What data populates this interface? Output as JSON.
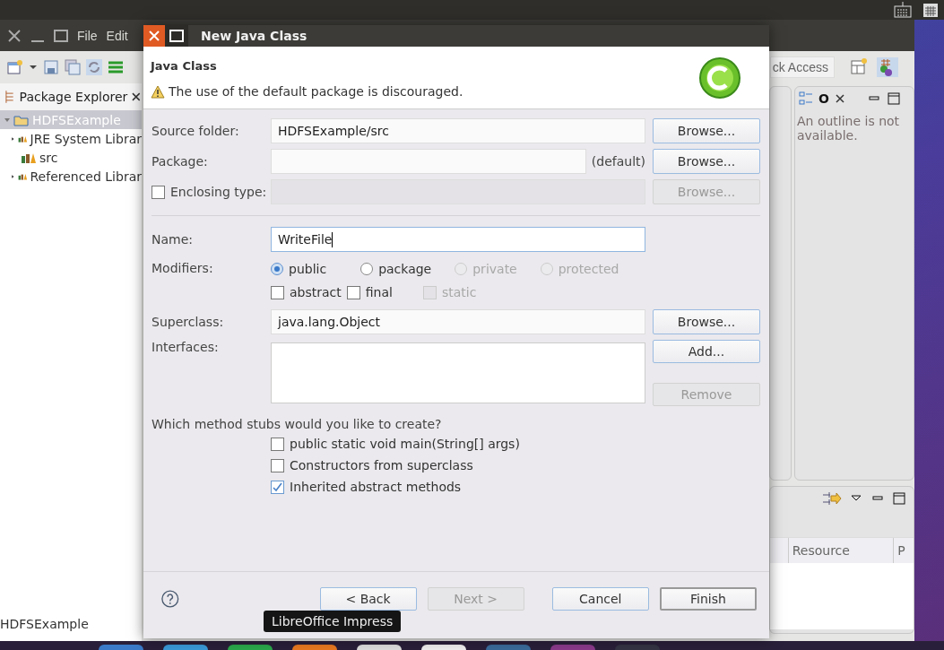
{
  "ide": {
    "menu": [
      "File",
      "Edit"
    ],
    "quick_access": "ck Access",
    "package_explorer": {
      "title": "Package Explorer",
      "tree": [
        {
          "label": "HDFSExample",
          "selected": true,
          "expanded": true,
          "children": [
            {
              "label": "JRE System Librar",
              "expanded": false
            },
            {
              "label": "src"
            },
            {
              "label": "Referenced Librar",
              "expanded": false
            }
          ]
        }
      ]
    },
    "outline": {
      "tab": "O",
      "message": "An outline is not available."
    },
    "problems": {
      "columns": [
        "Resource",
        "P"
      ]
    },
    "status_bar": "HDFSExample"
  },
  "dialog": {
    "title": "New Java Class",
    "header": {
      "title": "Java Class",
      "message": "The use of the default package is discouraged."
    },
    "source_folder": {
      "label": "Source folder:",
      "value": "HDFSExample/src",
      "button": "Browse..."
    },
    "package": {
      "label": "Package:",
      "suffix": "(default)",
      "button": "Browse..."
    },
    "enclosing_type": {
      "label": "Enclosing type:",
      "checked": false,
      "button": "Browse...",
      "disabled": true
    },
    "name": {
      "label": "Name:",
      "value": "WriteFile"
    },
    "modifiers": {
      "label": "Modifiers:",
      "options": [
        {
          "label": "public",
          "selected": true,
          "disabled": false
        },
        {
          "label": "package",
          "selected": false,
          "disabled": false
        },
        {
          "label": "private",
          "selected": false,
          "disabled": true
        },
        {
          "label": "protected",
          "selected": false,
          "disabled": true
        }
      ],
      "flags": [
        {
          "label": "abstract",
          "checked": false,
          "disabled": false
        },
        {
          "label": "final",
          "checked": false,
          "disabled": false
        },
        {
          "label": "static",
          "checked": false,
          "disabled": true
        }
      ]
    },
    "superclass": {
      "label": "Superclass:",
      "value": "java.lang.Object",
      "button": "Browse..."
    },
    "interfaces": {
      "label": "Interfaces:",
      "buttons": [
        {
          "label": "Add...",
          "disabled": false
        },
        {
          "label": "Remove",
          "disabled": true
        }
      ]
    },
    "stubs": {
      "question": "Which method stubs would you like to create?",
      "options": [
        {
          "label": "public static void main(String[] args)",
          "checked": false
        },
        {
          "label": "Constructors from superclass",
          "checked": false
        },
        {
          "label": "Inherited abstract methods",
          "checked": true
        }
      ]
    },
    "buttons": [
      {
        "label": "< Back",
        "disabled": false,
        "default": false
      },
      {
        "label": "Next >",
        "disabled": true,
        "default": false
      },
      {
        "label": "Cancel",
        "disabled": false,
        "default": false
      },
      {
        "label": "Finish",
        "disabled": false,
        "default": true
      }
    ]
  },
  "tooltip": "LibreOffice Impress"
}
